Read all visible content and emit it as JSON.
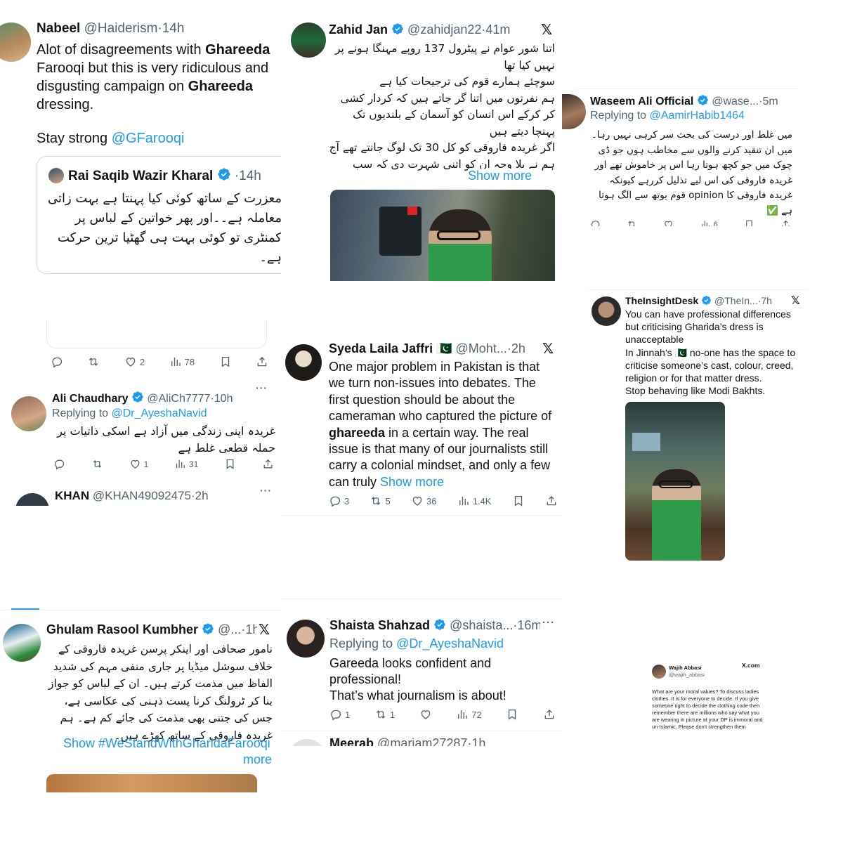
{
  "tweets": {
    "nabeel": {
      "name": "Nabeel",
      "handle": "@Haiderism",
      "time": "14h",
      "text_1": "Alot of disagreements with ",
      "bold_1": "Ghareeda",
      "text_2": " Farooqi but this is very ridiculous and disgusting campaign on ",
      "bold_2": "Ghareeda",
      "text_3": " dressing.",
      "stay": "Stay strong ",
      "mention": "@GFarooqi",
      "quote": {
        "name": "Rai Saqib Wazir Kharal",
        "time": "14h",
        "text": "معزرت کے ساتھ کوئی کیا پہنتا ہے بہت زاتی معاملہ ہے۔۔اور پھر خواتین کے لباس پر کمنٹری تو کوئی بہت ہی گھٹیا ترین حرکت ہے۔"
      }
    },
    "first_actions": {
      "likes": "2",
      "views": "78"
    },
    "ali": {
      "name": "Ali Chaudhary",
      "handle": "@AliCh7777",
      "time": "10h",
      "replying_to": "Replying to ",
      "reply_handle": "@Dr_AyeshaNavid",
      "text": "غریدہ اپنی زندگی میں آزاد ہے اسکی ذاتیات پر حملہ قطعی غلط ہے",
      "likes": "1",
      "views": "31"
    },
    "khan": {
      "name": "KHAN",
      "handle": "@KHAN49092475",
      "time": "2h"
    },
    "zahid": {
      "name": "Zahid Jan",
      "handle": "@zahidjan22",
      "time": "41m",
      "text": "اتنا شور عوام نے پیٹرول 137 روپے مہنگا ہونے پر نہیں کیا تھا\nسوچئے ہمارے قوم کی ترجیحات کیا ہے\nہم نفرتوں میں اتنا گر جاتے ہیں کہ کردار کشی کر کرکے اس انسان کو آسمان کے بلندیوں تک پہنچا دیتے ہیں\nاگر غریدہ فاروقی کو کل 30 تک لوگ جانتے تھے آج ہم نے بلا وجہ ان کو اتنی شہرت دی کہ سب",
      "show_more": "Show more"
    },
    "laila": {
      "name": "Syeda Laila Jaffri",
      "flag": "🇵🇰",
      "handle": "@Moht...",
      "time": "2h",
      "text_1": "One major problem in Pakistan is that we turn non-issues into debates. The first question should be about the cameraman who captured the picture of ",
      "bold": "ghareeda",
      "text_2": "  in a certain way. The real issue is that many of our journalists still carry a colonial mindset, and only a few can truly ",
      "show_more": "Show more",
      "replies": "3",
      "reposts": "5",
      "likes": "36",
      "views": "1.4K"
    },
    "waseem": {
      "name": "Waseem Ali Official",
      "handle": "@wase...",
      "time": "5m",
      "replying_to": "Replying to ",
      "reply_handle": "@AamirHabib1464",
      "text": "میں غلط اور درست کی بحث سر کرہی نہیں رہا۔\nمیں ان تنقید کرنے والوں سے مخاطب ہوں جو ڈی چوک میں جو کچھ ہوتا رہا اس پر خاموش تھے اور غریدہ فاروقی کی اس لیے تذلیل کررہے کیونکہ غریدہ فاروقی کا opinion قوم یوتھ سے الگ ہوتا ہے ✅",
      "views": "6"
    },
    "insight": {
      "name": "TheInsightDesk",
      "handle": "@TheIn...",
      "time": "7h",
      "text": "You can have professional differences but criticising Gharida’s dress is unacceptable\nIn Jinnah’s 🇵🇰 no-one has the space to criticise someone’s cast, colour, creed, religion or for that matter dress.\nStop behaving like Modi Bakhts."
    },
    "ghulam": {
      "name": "Ghulam Rasool Kumbher",
      "handle": "@...",
      "time": "1h",
      "text": "نامور صحافی اور اینکر پرسن غریدہ فاروقی کے خلاف سوشل میڈیا پر جاری منفی مہم کی شدید الفاظ میں مذمت کرتے ہیں۔ ان کے لباس کو جواز بنا کر ٹرولنگ کرنا پست ذہنی کی عکاسی ہے، جس کی جتنی بھی مذمت کی جائے کم ہے۔ ہم غریدہ فاروقی کے ساتھ کھڑے ہیں۔",
      "show": "Show ",
      "hashtag": "#WeStandWithGharidaFarooqi",
      "more": "more"
    },
    "shaista": {
      "name": "Shaista Shahzad",
      "handle": "@shaista...",
      "time": "16m",
      "replying_to": "Replying to ",
      "reply_handle": "@Dr_AyeshaNavid",
      "text": "Gareeda looks confident and professional!\nThat’s what journalism is about!",
      "replies": "1",
      "reposts": "1",
      "views": "72"
    },
    "meerab": {
      "name": "Meerab",
      "handle": "@mariam27287",
      "time": "1h"
    },
    "wajih": {
      "name": "Wajih Abbasi",
      "handle": "@wajih_abbasi",
      "brand": "X.com",
      "text": "What are your moral values? To discuss ladies clothes. It is for everyone to decide. If you give someone right to decide the clothing code then remember there are millions who say what you are wearing in picture at your DP is immoral and un-Islamic. Please don't strengthen them"
    }
  },
  "misc": {
    "sep": "·",
    "dots": "···",
    "x_logo": "𝕏"
  },
  "colors": {
    "link": "#1d9bf0",
    "verified": "#1d9bf0",
    "text": "#0f1419",
    "muted": "#536471",
    "green": "#2e8b3e"
  }
}
